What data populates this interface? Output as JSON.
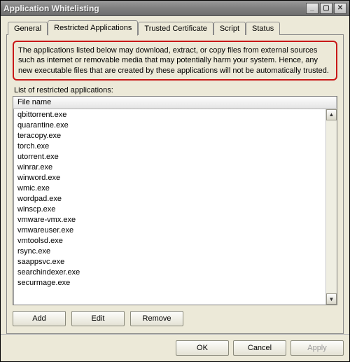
{
  "window": {
    "title": "Application Whitelisting"
  },
  "tabs": [
    {
      "label": "General"
    },
    {
      "label": "Restricted Applications"
    },
    {
      "label": "Trusted Certificate"
    },
    {
      "label": "Script"
    },
    {
      "label": "Status"
    }
  ],
  "activeTab": 1,
  "description": "The applications listed below may download, extract, or copy files from external sources such as internet or removable media that may potentially harm your system. Hence, any new executable files that are created by these applications will not be automatically trusted.",
  "listLabel": "List of restricted applications:",
  "listHeader": "File name",
  "items": [
    "qbittorrent.exe",
    "quarantine.exe",
    "teracopy.exe",
    "torch.exe",
    "utorrent.exe",
    "winrar.exe",
    "winword.exe",
    "wmic.exe",
    "wordpad.exe",
    "winscp.exe",
    "vmware-vmx.exe",
    "vmwareuser.exe",
    "vmtoolsd.exe",
    "rsync.exe",
    "saappsvc.exe",
    "searchindexer.exe",
    "securmage.exe"
  ],
  "buttons": {
    "add": "Add",
    "edit": "Edit",
    "remove": "Remove",
    "ok": "OK",
    "cancel": "Cancel",
    "apply": "Apply"
  }
}
